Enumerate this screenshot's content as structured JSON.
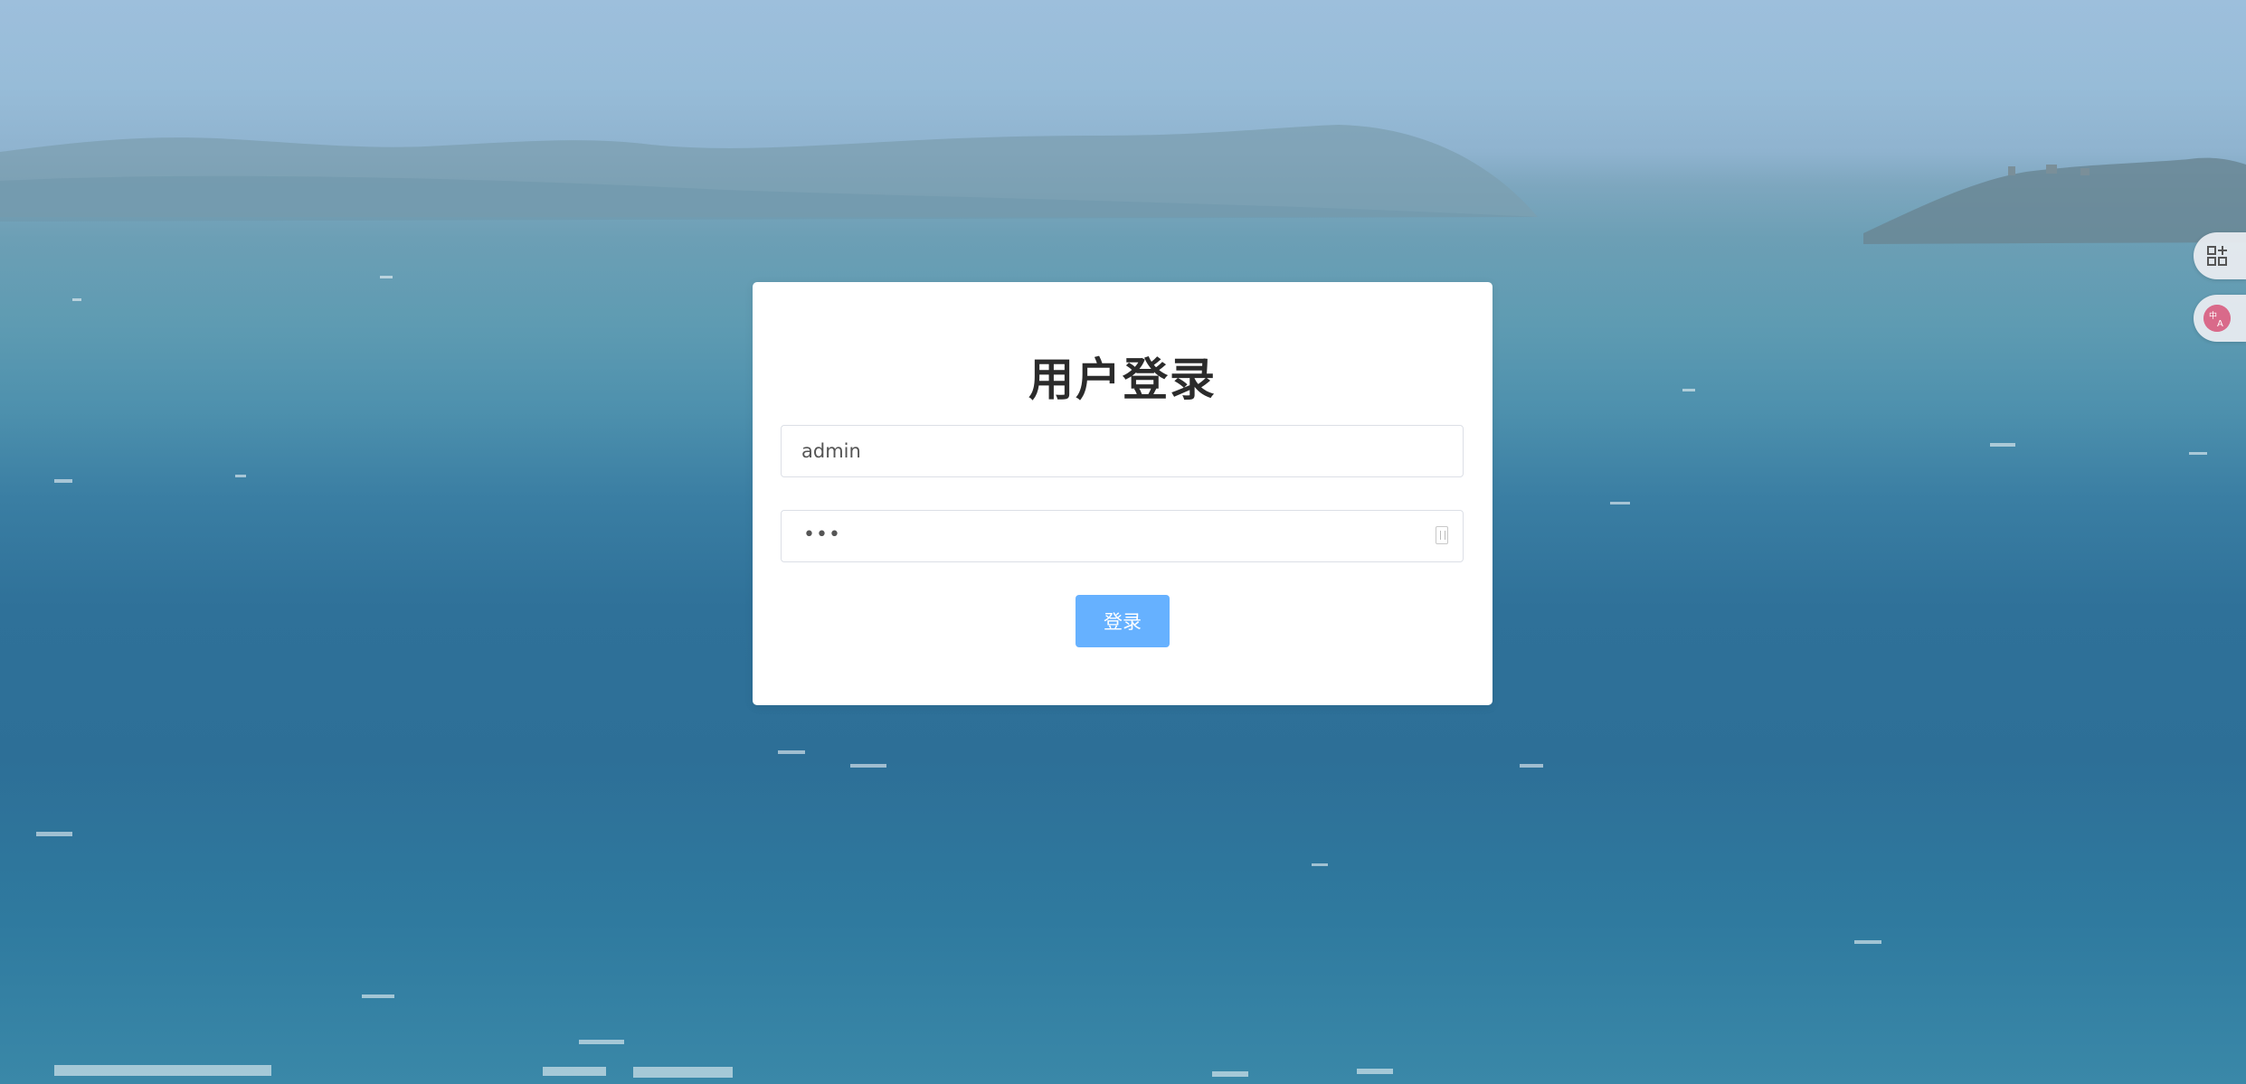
{
  "login": {
    "title": "用户登录",
    "username_value": "admin",
    "password_mask": "•••",
    "submit_label": "登录"
  },
  "side_tools": {
    "apps_icon": "apps-add-icon",
    "translate_icon": "translate-icon"
  },
  "colors": {
    "primary_button": "#66b1ff",
    "translate_badge": "#d96a8a"
  }
}
